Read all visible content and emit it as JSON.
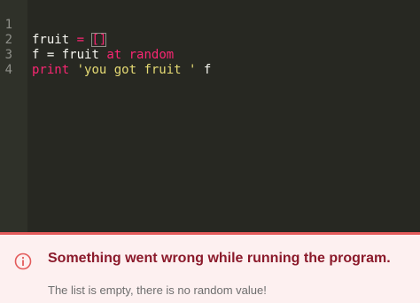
{
  "editor": {
    "lines": [
      {
        "num": "1",
        "tokens": [
          "fruit",
          " = ",
          "[]"
        ]
      },
      {
        "num": "2",
        "tokens": [
          "f",
          " = ",
          "fruit",
          " at random"
        ]
      },
      {
        "num": "3",
        "tokens": [
          "print",
          " 'you got fruit '",
          " f"
        ]
      },
      {
        "num": "4",
        "tokens": []
      }
    ]
  },
  "error": {
    "icon": "info-circle-icon",
    "title": "Something went wrong while running the program.",
    "message": "The list is empty, there is no random value!"
  },
  "colors": {
    "editor_bg": "#272822",
    "keyword": "#f92672",
    "string": "#e6db74",
    "error_border": "#e35b5b",
    "error_title": "#8b1a2b"
  }
}
